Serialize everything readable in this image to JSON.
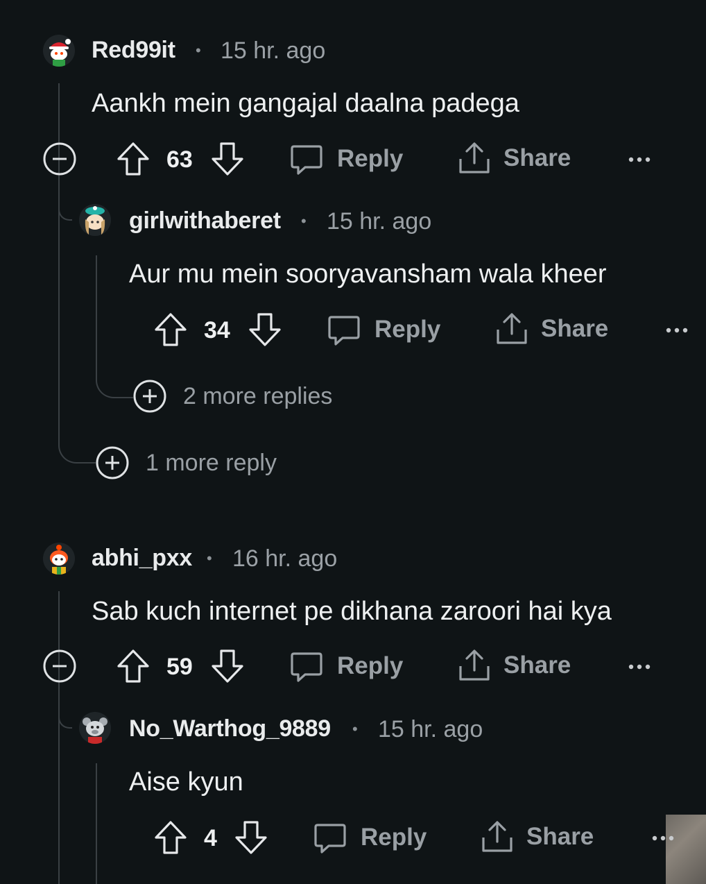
{
  "comments": [
    {
      "username": "Red99it",
      "separator": "•",
      "time": "15 hr. ago",
      "text": "Aankh mein gangajal daalna padega",
      "score": "63",
      "reply_label": "Reply",
      "share_label": "Share",
      "more_label": "•••",
      "more_replies": "1 more reply",
      "replies": [
        {
          "username": "girlwithaberet",
          "separator": "•",
          "time": "15 hr. ago",
          "text": "Aur mu mein sooryavansham wala kheer",
          "score": "34",
          "reply_label": "Reply",
          "share_label": "Share",
          "more_label": "•••",
          "more_replies": "2 more replies"
        }
      ]
    },
    {
      "username": "abhi_pxx",
      "separator": "•",
      "time": "16 hr. ago",
      "text": "Sab kuch internet pe dikhana zaroori hai kya",
      "score": "59",
      "reply_label": "Reply",
      "share_label": "Share",
      "more_label": "•••",
      "replies": [
        {
          "username": "No_Warthog_9889",
          "separator": "•",
          "time": "15 hr. ago",
          "text": "Aise kyun",
          "score": "4",
          "reply_label": "Reply",
          "share_label": "Share",
          "more_label": "•••"
        }
      ]
    }
  ],
  "icons": {
    "upvote": "arrow-up-outline-icon",
    "downvote": "arrow-down-outline-icon",
    "reply": "speech-bubble-icon",
    "share": "share-upload-icon",
    "collapse": "minus-circle-icon",
    "expand": "plus-circle-icon",
    "overflow": "ellipsis-icon"
  },
  "colors": {
    "background": "#0f1416",
    "text_primary": "#eef0f1",
    "text_secondary": "#9aa0a5",
    "thread_line": "#3a4044"
  }
}
